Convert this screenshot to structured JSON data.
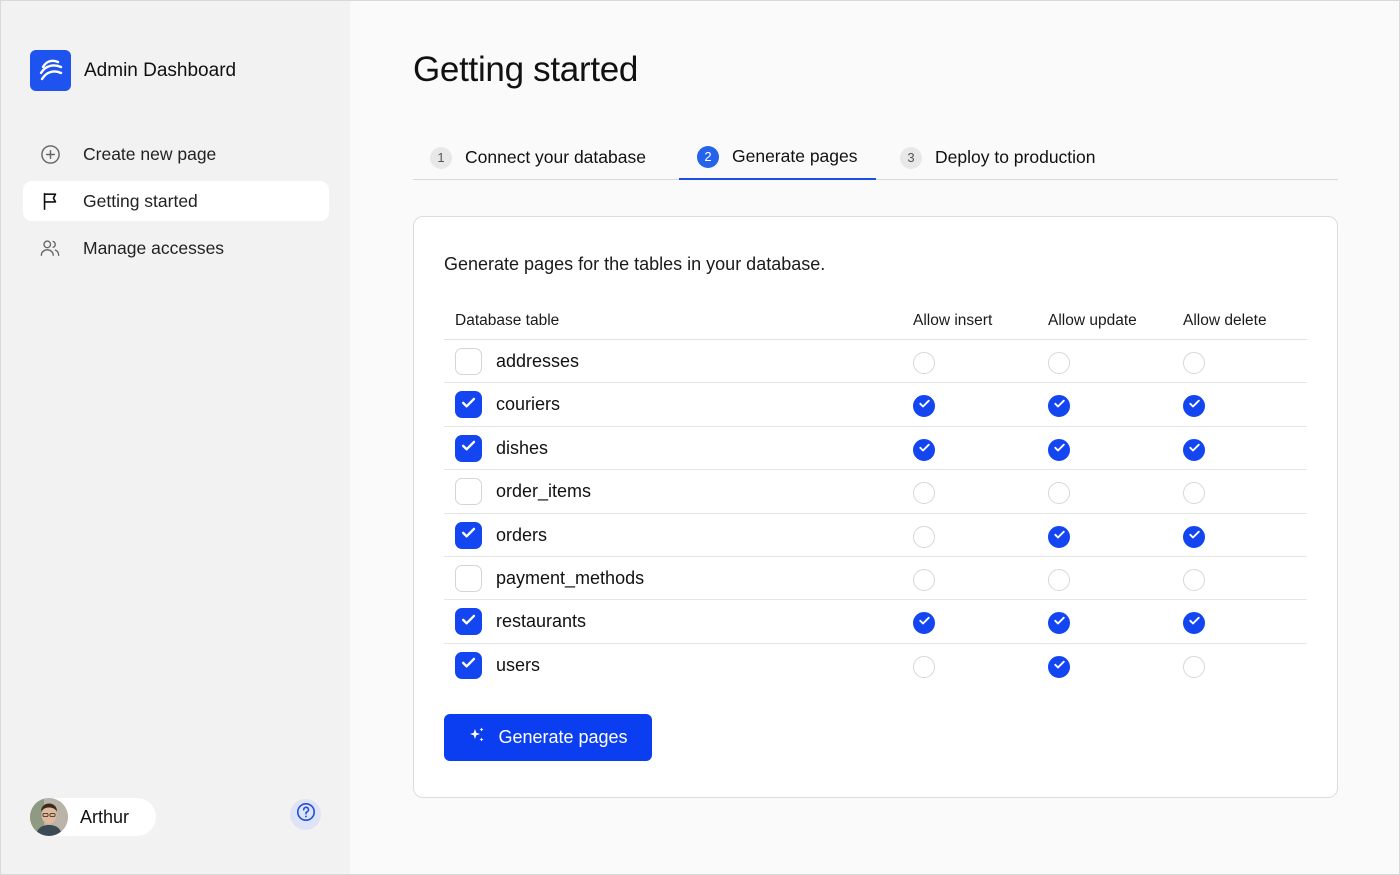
{
  "app": {
    "title": "Admin Dashboard",
    "logo_icon": "waves-logo-icon",
    "accent": "#1346f0"
  },
  "sidebar": {
    "items": [
      {
        "label": "Create new page",
        "icon": "plus-circle-icon",
        "active": false
      },
      {
        "label": "Getting started",
        "icon": "flag-icon",
        "active": true
      },
      {
        "label": "Manage accesses",
        "icon": "users-icon",
        "active": false
      }
    ],
    "user": {
      "name": "Arthur"
    },
    "help_icon": "help-circle-icon"
  },
  "main": {
    "title": "Getting started",
    "steps": [
      {
        "num": "1",
        "label": "Connect your database",
        "active": false
      },
      {
        "num": "2",
        "label": "Generate pages",
        "active": true
      },
      {
        "num": "3",
        "label": "Deploy to production",
        "active": false
      }
    ],
    "card": {
      "intro": "Generate pages for the tables in your database.",
      "columns": [
        "Database table",
        "Allow insert",
        "Allow update",
        "Allow delete"
      ],
      "rows": [
        {
          "name": "addresses",
          "selected": false,
          "insert": false,
          "update": false,
          "delete": false
        },
        {
          "name": "couriers",
          "selected": true,
          "insert": true,
          "update": true,
          "delete": true
        },
        {
          "name": "dishes",
          "selected": true,
          "insert": true,
          "update": true,
          "delete": true
        },
        {
          "name": "order_items",
          "selected": false,
          "insert": false,
          "update": false,
          "delete": false
        },
        {
          "name": "orders",
          "selected": true,
          "insert": false,
          "update": true,
          "delete": true
        },
        {
          "name": "payment_methods",
          "selected": false,
          "insert": false,
          "update": false,
          "delete": false
        },
        {
          "name": "restaurants",
          "selected": true,
          "insert": true,
          "update": true,
          "delete": true
        },
        {
          "name": "users",
          "selected": true,
          "insert": false,
          "update": true,
          "delete": false
        }
      ],
      "button": {
        "label": "Generate pages",
        "icon": "sparkles-icon"
      }
    }
  }
}
